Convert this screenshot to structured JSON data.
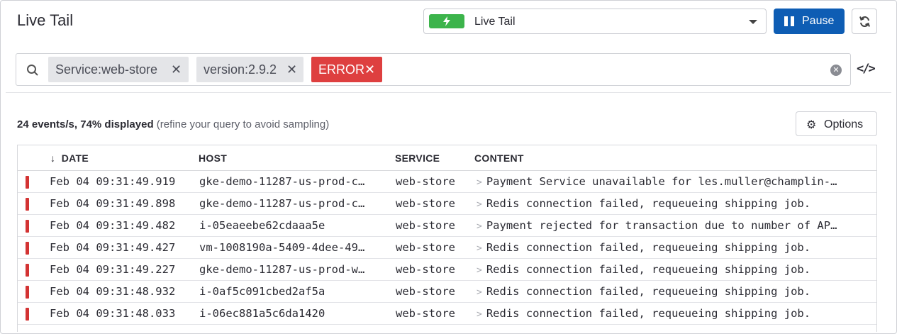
{
  "header": {
    "title": "Live Tail",
    "mode_select": {
      "selected": "Live Tail",
      "badge_color": "#3cb44b"
    },
    "pause_label": "Pause"
  },
  "search": {
    "filters": [
      {
        "label": "Service:web-store",
        "color": "#e4e5e8"
      },
      {
        "label": "version:2.9.2",
        "color": "#e4e5e8"
      },
      {
        "label": "ERROR",
        "color": "#de3f3f"
      }
    ]
  },
  "stats": {
    "bold": "24 events/s, 74% displayed",
    "hint": "(refine your query to avoid sampling)"
  },
  "options_label": "Options",
  "table": {
    "columns": [
      "DATE",
      "HOST",
      "SERVICE",
      "CONTENT"
    ],
    "sort_indicator": "↓",
    "rows": [
      {
        "date": "Feb 04 09:31:49.919",
        "host": "gke-demo-11287-us-prod-c…",
        "service": "web-store",
        "content": "Payment Service unavailable for les.muller@champlin-…"
      },
      {
        "date": "Feb 04 09:31:49.898",
        "host": "gke-demo-11287-us-prod-c…",
        "service": "web-store",
        "content": "Redis connection failed, requeueing shipping job."
      },
      {
        "date": "Feb 04 09:31:49.482",
        "host": "i-05eaeebe62cdaaa5e",
        "service": "web-store",
        "content": "Payment rejected for transaction due to number of AP…"
      },
      {
        "date": "Feb 04 09:31:49.427",
        "host": "vm-1008190a-5409-4dee-49…",
        "service": "web-store",
        "content": "Redis connection failed, requeueing shipping job."
      },
      {
        "date": "Feb 04 09:31:49.227",
        "host": "gke-demo-11287-us-prod-w…",
        "service": "web-store",
        "content": "Redis connection failed, requeueing shipping job."
      },
      {
        "date": "Feb 04 09:31:48.932",
        "host": "i-0af5c091cbed2af5a",
        "service": "web-store",
        "content": "Redis connection failed, requeueing shipping job."
      },
      {
        "date": "Feb 04 09:31:48.033",
        "host": "i-06ec881a5c6da1420",
        "service": "web-store",
        "content": "Redis connection failed, requeueing shipping job."
      }
    ],
    "status_color": "#d33333"
  },
  "colors": {
    "primary": "#0e5db4",
    "success": "#3cb44b",
    "error": "#de3f3f"
  }
}
